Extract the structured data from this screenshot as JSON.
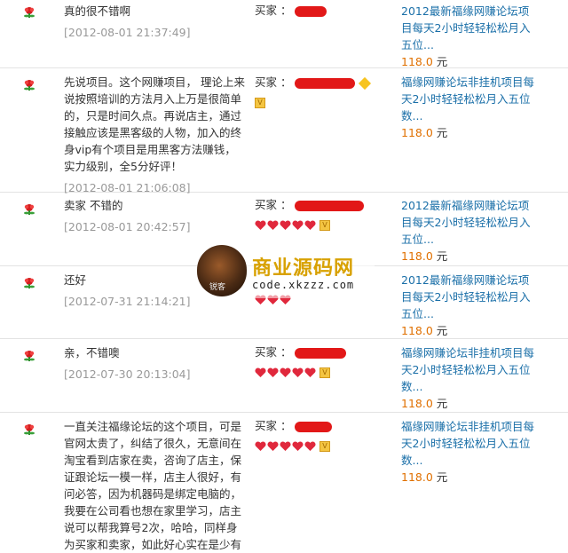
{
  "labels": {
    "buyer": "买家 ：",
    "currency": "元"
  },
  "colors": {
    "redaction": "#e21818",
    "item_link": "#1a6fa8",
    "price": "#e07000"
  },
  "reviews": [
    {
      "content": "真的很不错啊",
      "date": "[2012-08-01 21:37:49]",
      "item_title": "2012最新福缘网赚论坛项目每天2小时轻轻松松月入五位...",
      "price": "118.0"
    },
    {
      "content": "先说项目。这个网赚项目， 理论上来说按照培训的方法月入上万是很简单的，只是时间久点。再说店主，通过接触应该是黑客级的人物，加入的终身vip有个项目是用黑客方法赚钱，实力级别，全5分好评！",
      "date": "[2012-08-01 21:06:08]",
      "item_title": "福缘网赚论坛非挂机项目每天2小时轻轻松松月入五位数...",
      "price": "118.0"
    },
    {
      "content": "卖家 不错的",
      "date": "[2012-08-01 20:42:57]",
      "item_title": "2012最新福缘网赚论坛项目每天2小时轻轻松松月入五位...",
      "price": "118.0"
    },
    {
      "content": "还好",
      "date": "[2012-07-31 21:14:21]",
      "item_title": "2012最新福缘网赚论坛项目每天2小时轻轻松松月入五位...",
      "price": "118.0"
    },
    {
      "content": "亲，不错噢",
      "date": "[2012-07-30 20:13:04]",
      "item_title": "福缘网赚论坛非挂机项目每天2小时轻轻松松月入五位数...",
      "price": "118.0"
    },
    {
      "content": "一直关注福缘论坛的这个项目，可是官网太贵了，纠结了很久，无意间在淘宝看到店家在卖，咨询了店主，保证跟论坛一模一样，店主人很好，有问必答，因为机器码是绑定电脑的，我要在公司看也想在家里学习，店主说可以帮我算号2次，哈哈，同样身为买家和卖家，如此好心实在是少有",
      "item_title": "福缘网赚论坛非挂机项目每天2小时轻轻松松月入五位数...",
      "price": "118.0"
    }
  ],
  "watermark": {
    "title": "商业源码网",
    "url": "code.xkzzz.com",
    "logo_text": "锐客"
  }
}
